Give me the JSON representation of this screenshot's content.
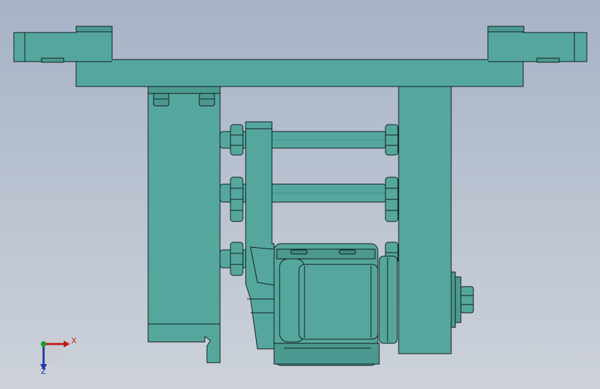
{
  "view": {
    "background_top": "#a6b2c6",
    "background_bottom": "#cdd2da",
    "part_color": "#55a79e",
    "part_shade": "#3f8b83",
    "edge_color": "#101a18"
  },
  "triad": {
    "x_axis_label": "X",
    "z_axis_label": "Z",
    "x_color": "#c01818",
    "y_color": "#1c9b2e",
    "z_color": "#1d3aa8"
  }
}
